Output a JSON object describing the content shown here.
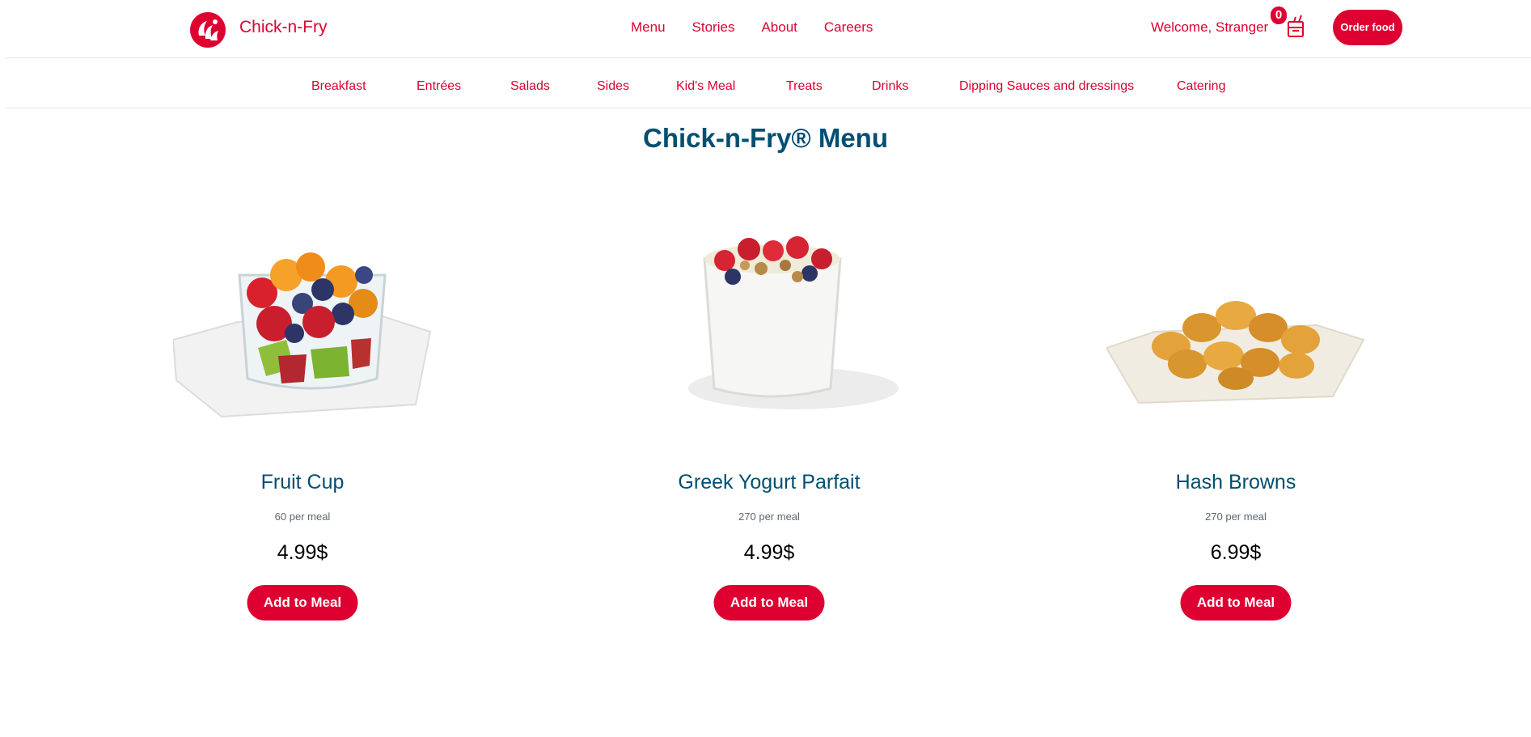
{
  "brand": {
    "name": "Chick-n-Fry",
    "accent_color": "#dd0031",
    "title_color": "#004f71"
  },
  "header": {
    "nav": [
      "Menu",
      "Stories",
      "About",
      "Careers"
    ],
    "welcome": "Welcome, Stranger",
    "cart_count": "0",
    "cart_icon": "food-bag-icon",
    "order_button": "Order food"
  },
  "categories": [
    "Breakfast",
    "Entrées",
    "Salads",
    "Sides",
    "Kid's Meal",
    "Treats",
    "Drinks",
    "Dipping Sauces and dressings",
    "Catering"
  ],
  "page_title": "Chick-n-Fry® Menu",
  "items": [
    {
      "name": "Fruit Cup",
      "calories": "60 per meal",
      "price": "4.99$",
      "button": "Add to Meal",
      "image": "fruit-cup-image"
    },
    {
      "name": "Greek Yogurt Parfait",
      "calories": "270 per meal",
      "price": "4.99$",
      "button": "Add to Meal",
      "image": "yogurt-parfait-image"
    },
    {
      "name": "Hash Browns",
      "calories": "270 per meal",
      "price": "6.99$",
      "button": "Add to Meal",
      "image": "hash-browns-image"
    }
  ]
}
